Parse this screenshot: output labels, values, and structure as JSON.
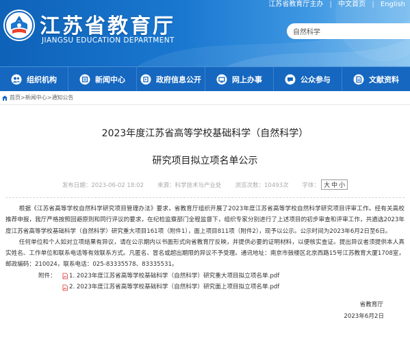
{
  "toplinks": {
    "left": "江苏省教育厅主办",
    "lang": "中文首页",
    "sep": "|",
    "english": "English"
  },
  "site": {
    "title": "江苏省教育厅",
    "subtitle": "JIANGSU EDUCATION DEPARTMENT"
  },
  "search": {
    "value": "自然科学"
  },
  "nav": [
    {
      "label": "组织机构",
      "icon": "organization-icon"
    },
    {
      "label": "新闻中心",
      "icon": "news-icon"
    },
    {
      "label": "政府信息公开",
      "icon": "info-disclosure-icon"
    },
    {
      "label": "网上办事",
      "icon": "online-service-icon"
    },
    {
      "label": "公众参与",
      "icon": "public-participation-icon"
    },
    {
      "label": "文献资料",
      "icon": "documents-icon"
    }
  ],
  "breadcrumb": {
    "items": [
      "首页",
      "新闻中心",
      "通知公告"
    ],
    "sep": ">"
  },
  "article": {
    "title_line1": "2023年度江苏省高等学校基础科学（自然科学）",
    "title_line2": "研究项目拟立项名单公示",
    "meta": {
      "published": "发布日期：2023-06-02 18:02",
      "source": "来源：科学技术与产业处",
      "views": "浏览次数：10493次",
      "fontsize_label": "字体：",
      "sizes": [
        "大",
        "中",
        "小"
      ]
    },
    "para1": "根据《江苏省高等学校自然科学研究项目管理办法》要求，省教育厅组织开展了2023年度江苏省高等学校自然科学研究项目评审工作。经有关高校推荐申报，我厅严格按照回避原则和同行评议的要求，在纪检监察部门全程监督下，组织专家分别进行了上述项目的初步审查和评审工作，共遴选2023年度江苏省高等学校基础科学（自然科学）研究重大项目161项（附件1），面上项目811项（附件2），现予以公示。公示时间为2023年6月2日至6日。",
    "para2": "任何单位和个人如对立项结果有异议，请在公示期内以书面形式向省教育厅反映，并提供必要的证明材料，以便核实查证。提出异议者须提供本人真实姓名、工作单位和联系电话等有效联系方式。凡匿名、冒名或超出期限的异议不予受理。通讯地址：南京市鼓楼区北京西路15号江苏教育大厦1708室，邮政编码：210024，联系电话：025-83335578、83335531。",
    "attachments_label": "附件：",
    "attachments": [
      "1. 2023年度江苏省高等学校基础科学（自然科学）研究重大项目拟立项名单.pdf",
      "2. 2023年度江苏省高等学校基础科学（自然科学）研究面上项目拟立项名单.pdf"
    ],
    "signer": "省教育厅",
    "sign_date": "2023年6月2日"
  }
}
